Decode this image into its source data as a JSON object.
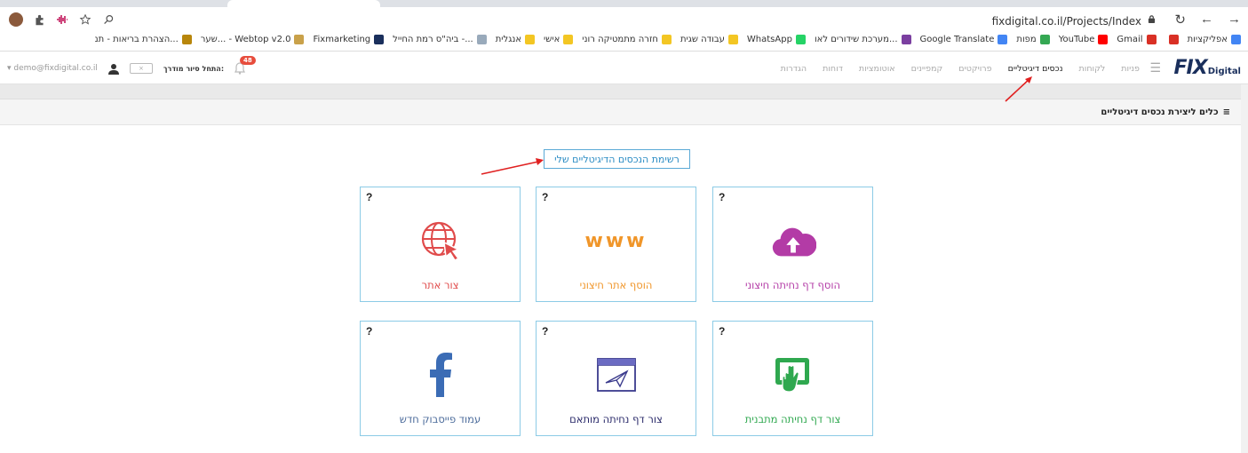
{
  "browser": {
    "url": "fixdigital.co.il/Projects/Index",
    "bookmarks": [
      {
        "label": "אפליקציות",
        "icon": "apps-grid-icon",
        "color": "#4285f4"
      },
      {
        "label": "",
        "icon": "gmail-icon",
        "color": "#d93025"
      },
      {
        "label": "Gmail",
        "icon": "gmail-icon",
        "color": "#d93025"
      },
      {
        "label": "YouTube",
        "icon": "youtube-icon",
        "color": "#ff0000"
      },
      {
        "label": "מפות",
        "icon": "maps-icon",
        "color": "#34a853"
      },
      {
        "label": "Google Translate",
        "icon": "translate-icon",
        "color": "#4285f4"
      },
      {
        "label": "מערכת שידורים לאו...",
        "icon": "broadcast-icon",
        "color": "#7b3fa0"
      },
      {
        "label": "WhatsApp",
        "icon": "whatsapp-icon",
        "color": "#25d366"
      },
      {
        "label": "עבודה שגית",
        "icon": "folder-icon",
        "color": "#f3c623"
      },
      {
        "label": "חזרה מתמטיקה רוני",
        "icon": "folder-icon",
        "color": "#f3c623"
      },
      {
        "label": "אישי",
        "icon": "folder-icon",
        "color": "#f3c623"
      },
      {
        "label": "אנגלית",
        "icon": "folder-icon",
        "color": "#f3c623"
      },
      {
        "label": "ביה\"ס רמת החייל -...",
        "icon": "school-icon",
        "color": "#9ab"
      },
      {
        "label": "Fixmarketing",
        "icon": "fix-icon",
        "color": "#1a2f5c"
      },
      {
        "label": "שער... - Webtop v2.0",
        "icon": "webtop-icon",
        "color": "#c9a14a"
      },
      {
        "label": "הצהרת בריאות - תנ...",
        "icon": "health-icon",
        "color": "#b8860b"
      }
    ]
  },
  "app": {
    "logo_main": "FIX",
    "logo_sub": "Digital",
    "nav": [
      {
        "label": "פניות",
        "active": false
      },
      {
        "label": "לקוחות",
        "active": false
      },
      {
        "label": "נכסים דיגיטליים",
        "active": true
      },
      {
        "label": "פרויקטים",
        "active": false
      },
      {
        "label": "קמפיינים",
        "active": false
      },
      {
        "label": "אוטומציות",
        "active": false
      },
      {
        "label": "דוחות",
        "active": false
      },
      {
        "label": "הגדרות",
        "active": false
      }
    ],
    "user_email": "demo@fixdigital.co.il",
    "tour_label": "התחל סיור מודרך:",
    "toggle_label": "×",
    "notifications_count": "48"
  },
  "panel": {
    "title": "כלים ליצירת נכסים דיגיטליים"
  },
  "list_button": "רשימת הנכסים הדיגיטליים שלי",
  "cards": [
    {
      "id": "create-site",
      "label": "צור אתר",
      "help": "?",
      "icon": "globe-cursor-icon",
      "color": "#e04b4b"
    },
    {
      "id": "add-external-site",
      "label": "הוסף אתר חיצוני",
      "help": "?",
      "icon": "www-icon",
      "icon_text": "www",
      "color": "#f0962a"
    },
    {
      "id": "add-external-landing",
      "label": "הוסף דף נחיתה חיצוני",
      "help": "?",
      "icon": "cloud-upload-icon",
      "color": "#b33ba6"
    },
    {
      "id": "facebook-page",
      "label": "עמוד פייסבוק חדש",
      "help": "?",
      "icon": "facebook-icon",
      "color": "#3b5998"
    },
    {
      "id": "custom-landing",
      "label": "צור דף נחיתה מותאם",
      "help": "?",
      "icon": "paper-plane-window-icon",
      "color": "#3a3a8c"
    },
    {
      "id": "template-landing",
      "label": "צור דף נחיתה מתבנית",
      "help": "?",
      "icon": "tap-screen-icon",
      "color": "#2fa84f"
    }
  ]
}
